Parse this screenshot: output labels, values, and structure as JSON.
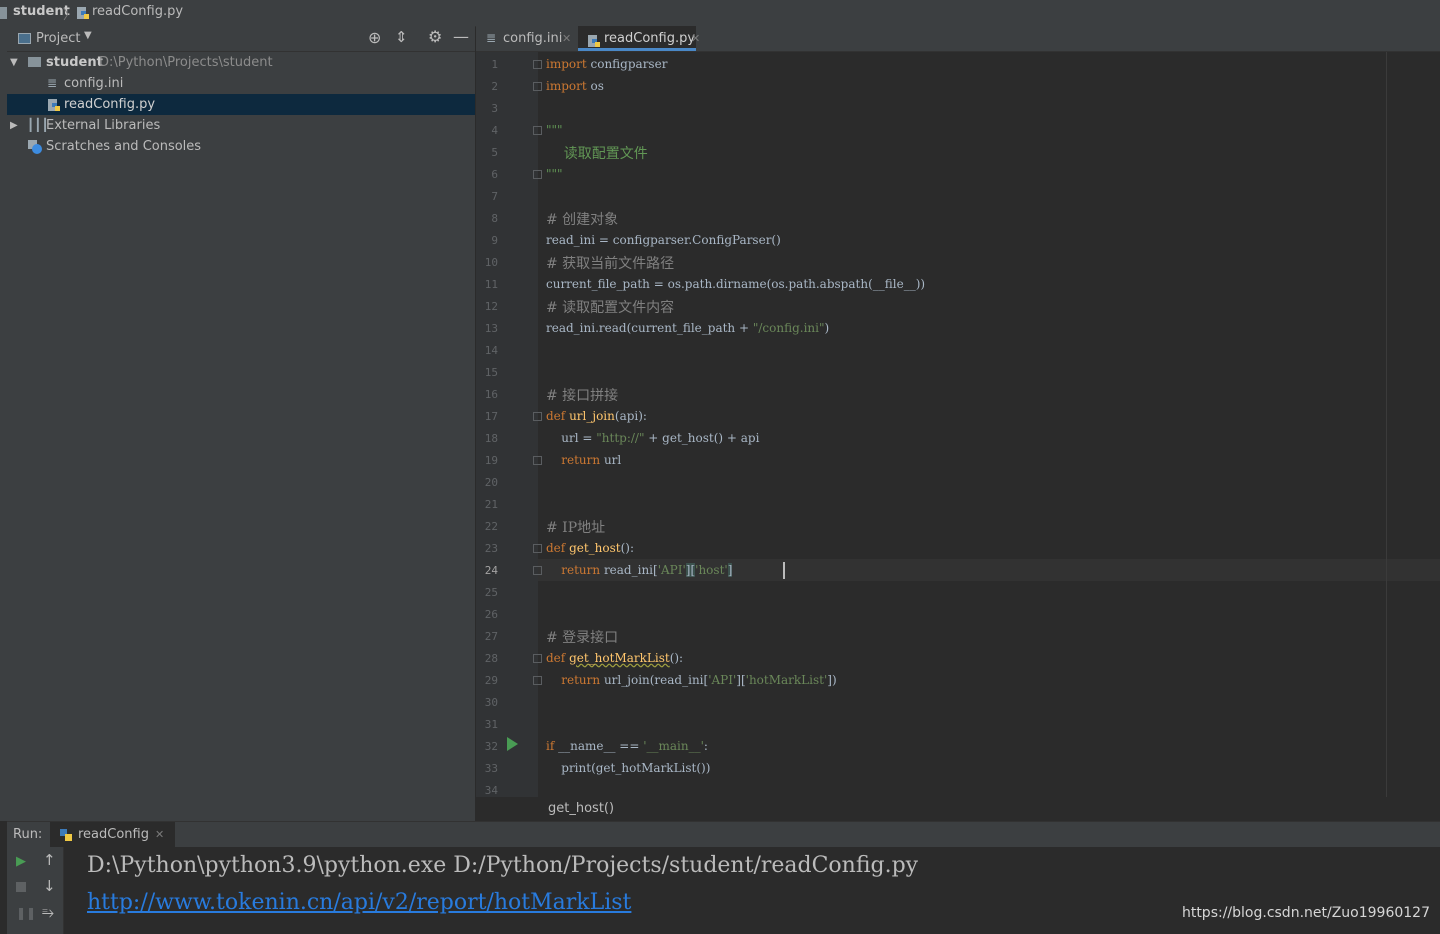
{
  "breadcrumb": {
    "project": "student",
    "file": "readConfig.py"
  },
  "project_panel": {
    "title": "Project",
    "tree": [
      {
        "name": "student",
        "path": "D:\\Python\\Projects\\student"
      },
      {
        "name": "config.ini"
      },
      {
        "name": "readConfig.py"
      },
      {
        "name": "External Libraries"
      },
      {
        "name": "Scratches and Consoles"
      }
    ]
  },
  "editor": {
    "tabs": [
      {
        "label": "config.ini",
        "active": false
      },
      {
        "label": "readConfig.py",
        "active": true
      }
    ],
    "line_numbers": [
      "1",
      "2",
      "3",
      "4",
      "5",
      "6",
      "7",
      "8",
      "9",
      "10",
      "11",
      "12",
      "13",
      "14",
      "15",
      "16",
      "17",
      "18",
      "19",
      "20",
      "21",
      "22",
      "23",
      "24",
      "25",
      "26",
      "27",
      "28",
      "29",
      "30",
      "31",
      "32",
      "33",
      "34"
    ],
    "code": {
      "l1": [
        "import",
        " configparser"
      ],
      "l2": [
        "import",
        " os"
      ],
      "l4": "\"\"\"",
      "l5": "    读取配置文件",
      "l6": "\"\"\"",
      "l8": "# 创建对象",
      "l9": "read_ini = configparser.ConfigParser()",
      "l10": "# 获取当前文件路径",
      "l11": "current_file_path = os.path.dirname(os.path.abspath(__file__))",
      "l12": "# 读取配置文件内容",
      "l13": [
        "read_ini.read(current_file_path + ",
        "\"/config.ini\"",
        ")"
      ],
      "l16": "# 接口拼接",
      "l17": [
        "def",
        " ",
        "url_join",
        "(api):"
      ],
      "l18": [
        "    url = ",
        "\"http://\"",
        " + get_host() + api"
      ],
      "l19": [
        "    ",
        "return",
        " url"
      ],
      "l22": "# IP地址",
      "l23": [
        "def",
        " ",
        "get_host",
        "():"
      ],
      "l24": [
        "    ",
        "return",
        " read_ini[",
        "'API'",
        "][",
        "'host'",
        "]"
      ],
      "l27": "# 登录接口",
      "l28": [
        "def",
        " ",
        "get_hotMarkList",
        "():"
      ],
      "l29": [
        "    ",
        "return",
        " url_join(read_ini[",
        "'API'",
        "][",
        "'hotMarkList'",
        "])"
      ],
      "l32": [
        "if",
        " __name__ == ",
        "'__main__'",
        ":"
      ],
      "l33": "    print(get_hotMarkList())"
    },
    "current_line": "24",
    "status_context": "get_host()"
  },
  "run_panel": {
    "label": "Run:",
    "tab": "readConfig",
    "output_command": "D:\\Python\\python3.9\\python.exe D:/Python/Projects/student/readConfig.py",
    "output_link": "http://www.tokenin.cn/api/v2/report/hotMarkList"
  },
  "watermark": "https://blog.csdn.net/Zuo19960127",
  "colors": {
    "keyword": "#cc7832",
    "string": "#6a8759",
    "comment": "#808080",
    "function": "#ffc66d",
    "link": "#287bde",
    "selection": "#0d293e"
  }
}
